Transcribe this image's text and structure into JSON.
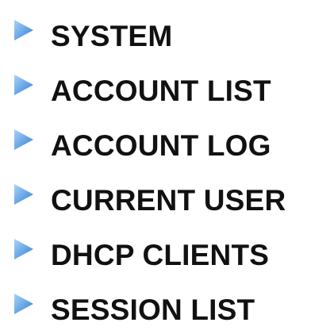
{
  "colors": {
    "arrow_light": "#7ab8f0",
    "arrow_dark": "#2f7fd6",
    "text": "#111111",
    "background": "#ffffff"
  },
  "menu": {
    "items": [
      {
        "label": "SYSTEM",
        "icon": "blue-triangle-arrow-icon"
      },
      {
        "label": "ACCOUNT LIST",
        "icon": "blue-triangle-arrow-icon"
      },
      {
        "label": "ACCOUNT LOG",
        "icon": "blue-triangle-arrow-icon"
      },
      {
        "label": "CURRENT USER",
        "icon": "blue-triangle-arrow-icon"
      },
      {
        "label": "DHCP CLIENTS",
        "icon": "blue-triangle-arrow-icon"
      },
      {
        "label": "SESSION LIST",
        "icon": "blue-triangle-arrow-icon"
      }
    ]
  }
}
